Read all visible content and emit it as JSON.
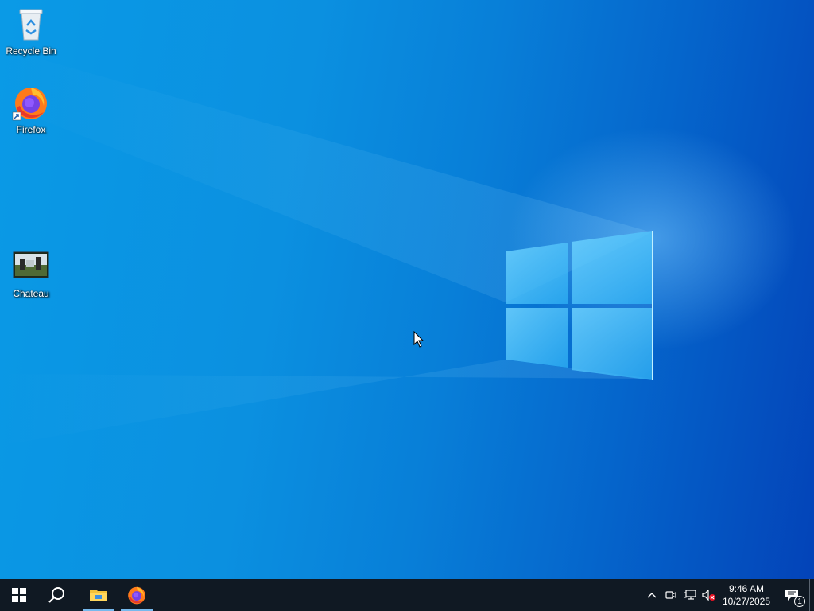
{
  "desktop": {
    "icons": [
      {
        "label": "Recycle Bin",
        "icon": "recycle-bin-icon"
      },
      {
        "label": "Firefox",
        "icon": "firefox-icon"
      },
      {
        "label": "Chateau",
        "icon": "image-file-icon"
      }
    ]
  },
  "taskbar": {
    "start_icon": "windows-start-icon",
    "search_icon": "search-icon",
    "pinned": [
      {
        "name": "File Explorer",
        "icon": "file-explorer-icon"
      },
      {
        "name": "Firefox",
        "icon": "firefox-icon"
      }
    ],
    "tray": {
      "icons": [
        "chevron-up-icon",
        "meet-now-icon",
        "network-icon",
        "volume-muted-icon"
      ],
      "time": "9:46 AM",
      "date": "10/27/2025",
      "notification_count": "1"
    }
  },
  "colors": {
    "taskbar_bg": "#101923",
    "desktop_blue": "#0b90e0",
    "accent": "#76b9ed"
  }
}
